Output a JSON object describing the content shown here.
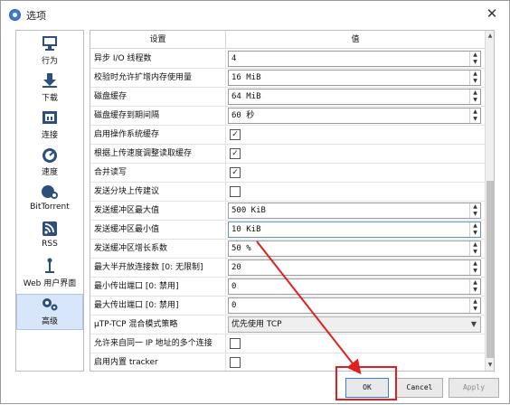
{
  "window": {
    "title": "选项",
    "close_glyph": "✕"
  },
  "sidebar": {
    "items": [
      {
        "label": "行为",
        "icon": "monitor-icon"
      },
      {
        "label": "下载",
        "icon": "download-icon"
      },
      {
        "label": "连接",
        "icon": "network-icon"
      },
      {
        "label": "速度",
        "icon": "speedometer-icon"
      },
      {
        "label": "BitTorrent",
        "icon": "bittorrent-icon"
      },
      {
        "label": "RSS",
        "icon": "rss-icon"
      },
      {
        "label": "Web 用户界面",
        "icon": "web-ui-icon"
      },
      {
        "label": "高级",
        "icon": "gears-icon",
        "selected": true
      }
    ]
  },
  "grid": {
    "headers": {
      "setting": "设置",
      "value": "值"
    },
    "rows": [
      {
        "label": "异步 I/O 线程数",
        "type": "spin",
        "value": "4"
      },
      {
        "label": "校验时允许扩增内存使用量",
        "type": "spin",
        "value": "16 MiB"
      },
      {
        "label": "磁盘缓存",
        "type": "spin",
        "value": "64 MiB"
      },
      {
        "label": "磁盘缓存到期间隔",
        "type": "spin",
        "value": "60 秒"
      },
      {
        "label": "启用操作系统缓存",
        "type": "check",
        "checked": true
      },
      {
        "label": "根据上传速度调整读取缓存",
        "type": "check",
        "checked": true
      },
      {
        "label": "合并读写",
        "type": "check",
        "checked": true
      },
      {
        "label": "发送分块上传建议",
        "type": "check",
        "checked": false
      },
      {
        "label": "发送缓冲区最大值",
        "type": "spin",
        "value": "500 KiB"
      },
      {
        "label": "发送缓冲区最小值",
        "type": "spin",
        "value": "10 KiB",
        "active": true
      },
      {
        "label": "发送缓冲区增长系数",
        "type": "spin",
        "value": "50 %"
      },
      {
        "label": "最大半开放连接数 [0: 无限制]",
        "type": "spin",
        "value": "20"
      },
      {
        "label": "最小传出端口 [0: 禁用]",
        "type": "spin",
        "value": "0"
      },
      {
        "label": "最大传出端口 [0: 禁用]",
        "type": "spin",
        "value": "0"
      },
      {
        "label": "µTP-TCP 混合模式策略",
        "type": "combo",
        "value": "优先使用 TCP"
      },
      {
        "label": "允许来自同一 IP 地址的多个连接",
        "type": "check",
        "checked": false
      },
      {
        "label": "启用内置 tracker",
        "type": "check",
        "checked": false
      }
    ]
  },
  "buttons": {
    "ok": "OK",
    "cancel": "Cancel",
    "apply": "Apply"
  },
  "colors": {
    "annotation": "#e02020",
    "selection": "#d7e6f8"
  }
}
